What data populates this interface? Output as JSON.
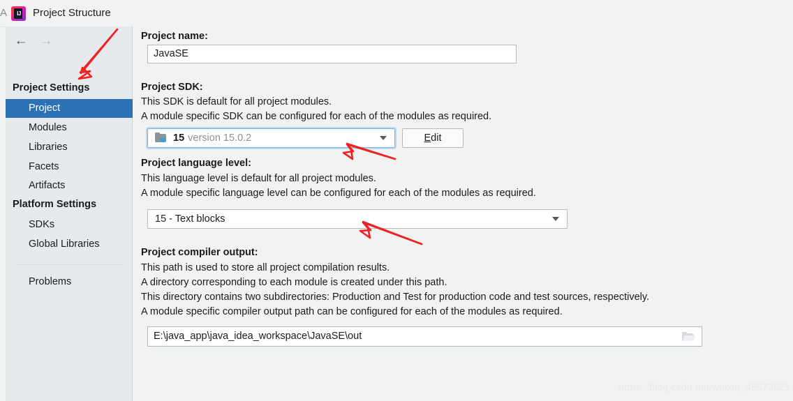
{
  "window": {
    "title": "Project Structure",
    "app_icon": "intellij-idea-icon",
    "titlebar_left_glyph": "A"
  },
  "sidebar": {
    "nav": {
      "back": "←",
      "forward": "→"
    },
    "groups": [
      {
        "header": "Project Settings",
        "items": [
          {
            "label": "Project",
            "selected": true
          },
          {
            "label": "Modules",
            "selected": false
          },
          {
            "label": "Libraries",
            "selected": false
          },
          {
            "label": "Facets",
            "selected": false
          },
          {
            "label": "Artifacts",
            "selected": false
          }
        ]
      },
      {
        "header": "Platform Settings",
        "items": [
          {
            "label": "SDKs",
            "selected": false
          },
          {
            "label": "Global Libraries",
            "selected": false
          }
        ]
      }
    ],
    "problems_label": "Problems",
    "selected_color": "#2a72b5",
    "background_color": "#e6eaed"
  },
  "main": {
    "project_name": {
      "label": "Project name:",
      "value": "JavaSE"
    },
    "project_sdk": {
      "label": "Project SDK:",
      "desc_line1": "This SDK is default for all project modules.",
      "desc_line2": "A module specific SDK can be configured for each of the modules as required.",
      "sdk_icon": "java-sdk-folder-icon",
      "value_name": "15",
      "value_version": "version 15.0.2",
      "dropdown_icon": "chevron-down-icon",
      "edit_button": {
        "mnemonic": "E",
        "rest": "dit"
      }
    },
    "language_level": {
      "label": "Project language level:",
      "desc_line1": "This language level is default for all project modules.",
      "desc_line2": "A module specific language level can be configured for each of the modules as required.",
      "value": "15 - Text blocks",
      "dropdown_icon": "chevron-down-icon"
    },
    "compiler_output": {
      "label": "Project compiler output:",
      "desc_line1": "This path is used to store all project compilation results.",
      "desc_line2": "A directory corresponding to each module is created under this path.",
      "desc_line3": "This directory contains two subdirectories: Production and Test for production code and test sources, respectively.",
      "desc_line4": "A module specific compiler output path can be configured for each of the modules as required.",
      "value": "E:\\java_app\\java_idea_workspace\\JavaSE\\out",
      "browse_icon": "folder-browse-icon"
    }
  },
  "annotations": {
    "color": "#ee2222",
    "arrows": [
      {
        "name": "arrow-to-project-item"
      },
      {
        "name": "arrow-to-sdk-combo"
      },
      {
        "name": "arrow-to-language-level-combo"
      }
    ]
  },
  "watermark": {
    "text": "https://blog.csdn.net/weixin_45573921"
  }
}
